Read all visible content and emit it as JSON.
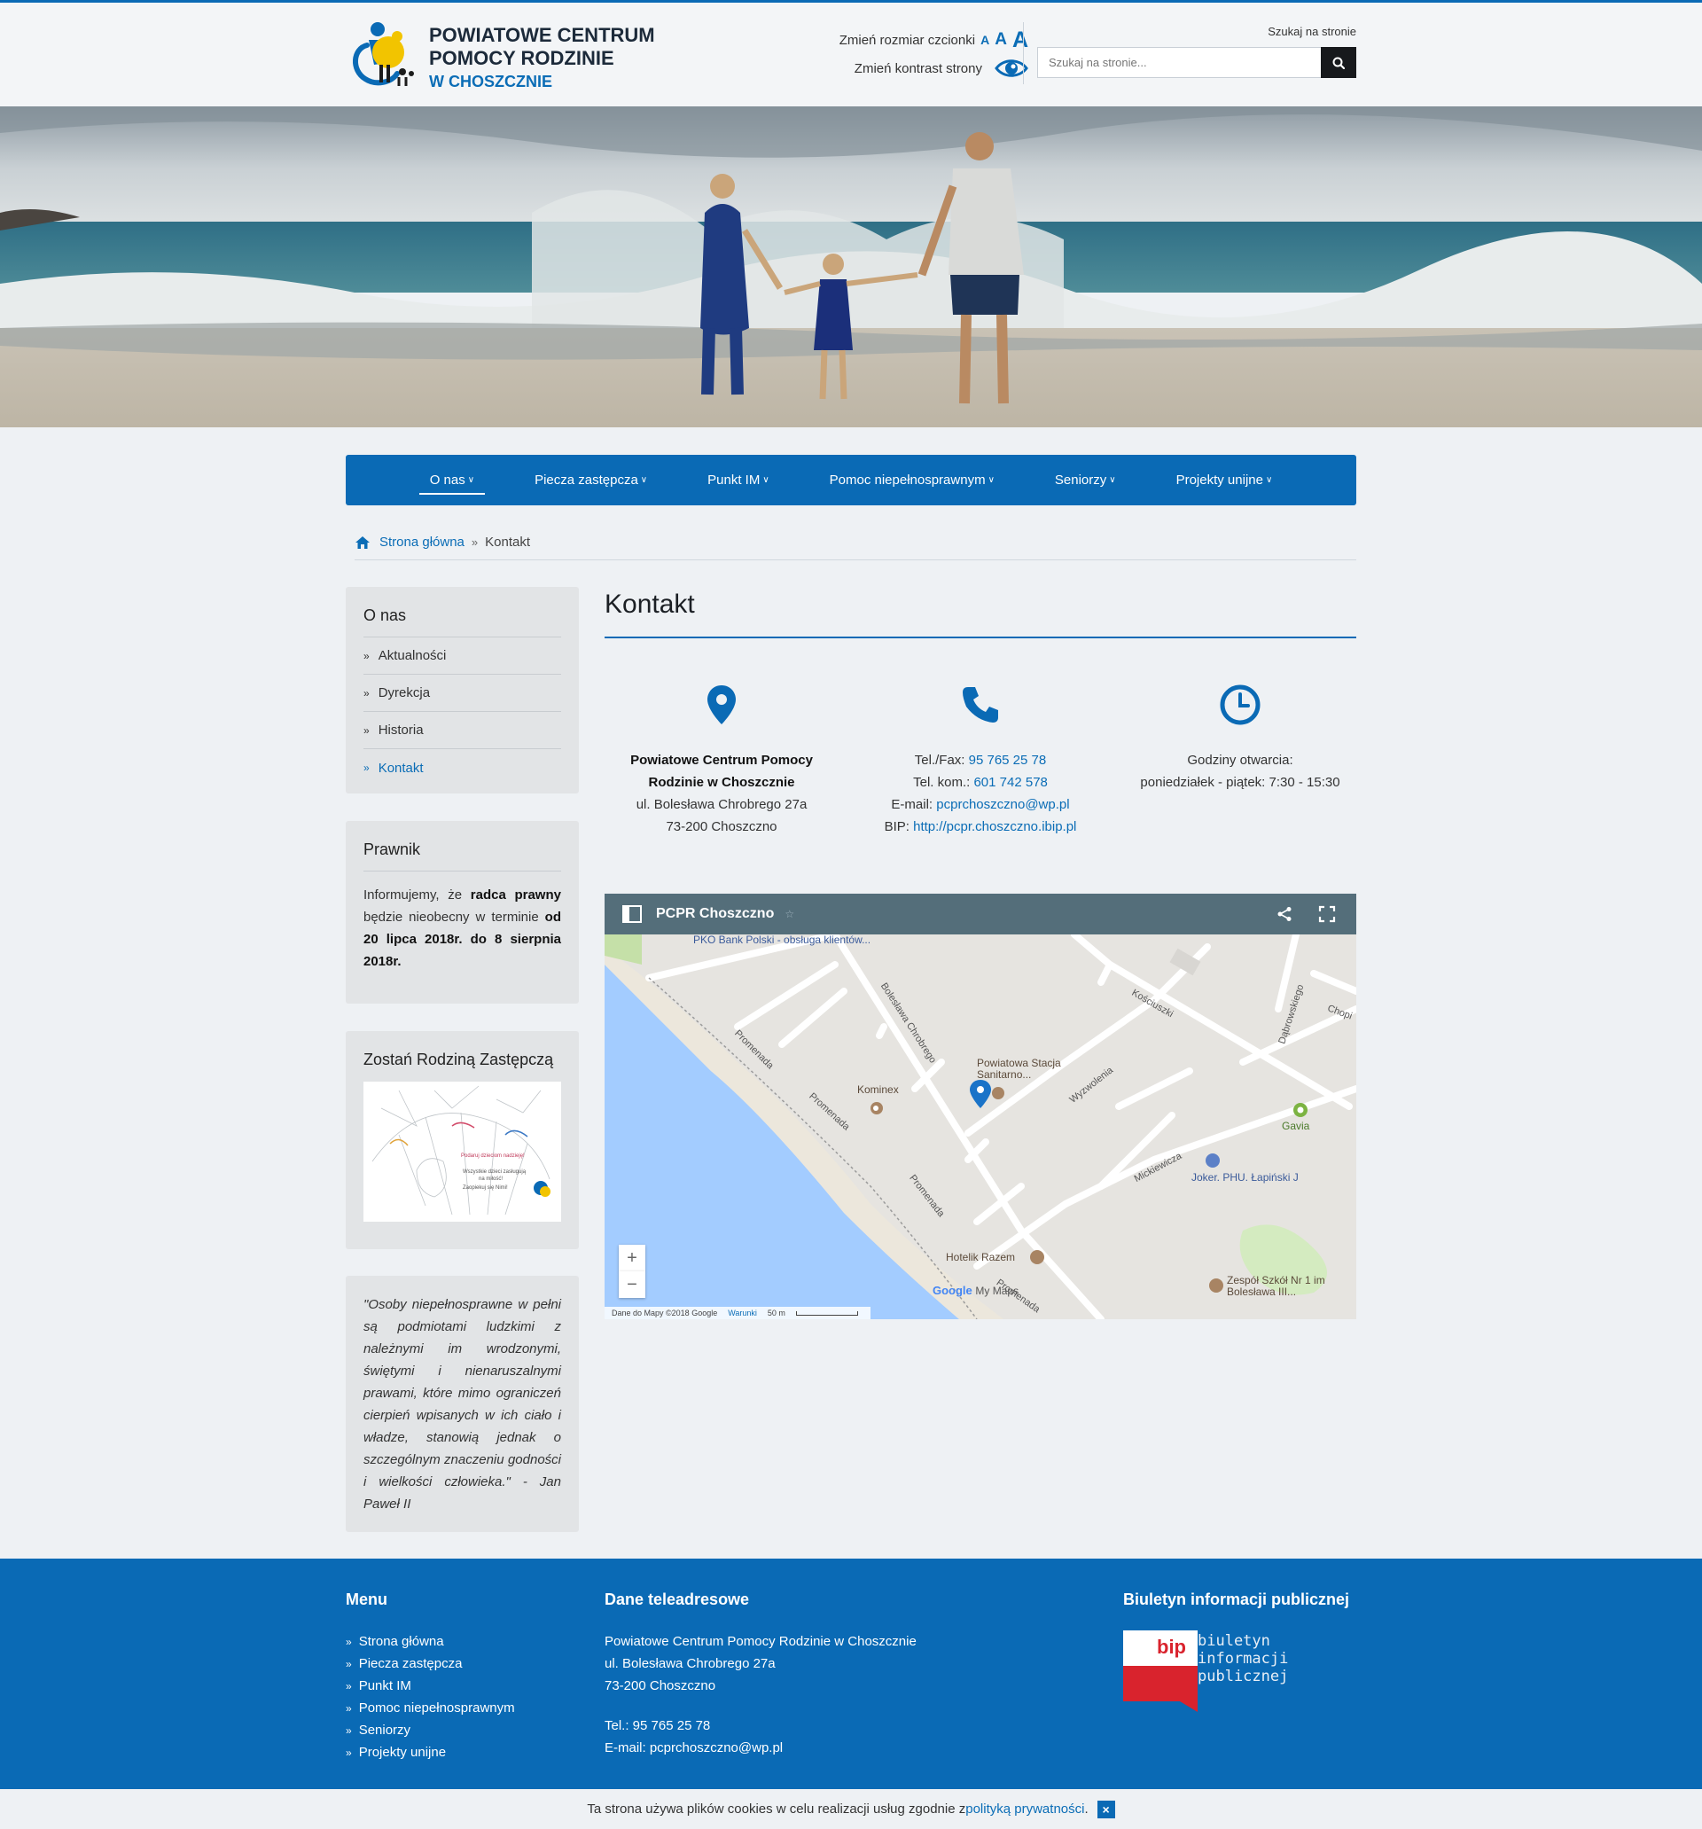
{
  "header": {
    "logo_line1": "POWIATOWE CENTRUM",
    "logo_line2": "POMOCY RODZINIE",
    "logo_line3": "W CHOSZCZNIE",
    "font_size_label": "Zmień rozmiar czcionki",
    "font_sizes": [
      "A",
      "A",
      "A"
    ],
    "contrast_label": "Zmień kontrast strony",
    "search_label": "Szukaj na stronie",
    "search_placeholder": "Szukaj na stronie..."
  },
  "nav": {
    "items": [
      {
        "label": "O nas"
      },
      {
        "label": "Piecza zastępcza"
      },
      {
        "label": "Punkt IM"
      },
      {
        "label": "Pomoc niepełnosprawnym"
      },
      {
        "label": "Seniorzy"
      },
      {
        "label": "Projekty unijne"
      }
    ]
  },
  "breadcrumb": {
    "home": "Strona główna",
    "current": "Kontakt"
  },
  "sidebar": {
    "onas": {
      "title": "O nas",
      "items": [
        "Aktualności",
        "Dyrekcja",
        "Historia",
        "Kontakt"
      ]
    },
    "prawnik": {
      "title": "Prawnik",
      "t1": "Informujemy, że ",
      "t2": "radca prawny",
      "t3": " będzie nieobecny w terminie ",
      "t4": "od 20 lipca 2018r. do 8 sierpnia 2018r."
    },
    "rodzina": {
      "title": "Zostań Rodziną Zastępczą",
      "poster_line1": "Podaruj dzieciom nadzieję!",
      "poster_line2": "Wszystkie dzieci zasługują",
      "poster_line3": "na miłość!",
      "poster_line4": "Zaopiekuj się Nimi!"
    },
    "quote": "\"Osoby niepełnosprawne w pełni są podmiotami ludzkimi z należnymi im wrodzonymi, świętymi i nienaruszalnymi prawami, które mimo ograniczeń cierpień wpisanych w ich ciało i władze, stanowią jednak o szczególnym znaczeniu godności i wielkości człowieka.\" - Jan Paweł II"
  },
  "main": {
    "title": "Kontakt",
    "address": {
      "name1": "Powiatowe Centrum Pomocy",
      "name2": "Rodzinie w Choszcznie",
      "street": "ul. Bolesława Chrobrego 27a",
      "city": "73-200 Choszczno"
    },
    "contact": {
      "tel_label": "Tel./Fax: ",
      "tel": "95 765 25 78",
      "mobile_label": "Tel. kom.: ",
      "mobile": "601 742 578",
      "email_label": "E-mail: ",
      "email": "pcprchoszczno@wp.pl",
      "bip_label": "BIP: ",
      "bip": "http://pcpr.choszczno.ibip.pl"
    },
    "hours": {
      "label": "Godziny otwarcia:",
      "value": "poniedziałek - piątek: 7:30 - 15:30"
    }
  },
  "map": {
    "title": "PCPR Choszczno",
    "places": {
      "pko": "PKO Bank Polski - obsługa klientów...",
      "stacja": "Powiatowa Stacja Sanitarno...",
      "kominex": "Kominex",
      "gavia": "Gavia",
      "joker": "Joker. PHU. Łapiński J",
      "hotelik": "Hotelik Razem",
      "zespol": "Zespół Szkół Nr 1 im Bolesława III..."
    },
    "streets": {
      "chrobrego": "Bolesława Chrobrego",
      "kosciuszki": "Kościuszki",
      "dabrowskiego": "Dąbrowskiego",
      "chopina": "Chopi",
      "wyzwolenia": "Wyzwolenia",
      "mickiewicza": "Mickiewicza",
      "promenada": "Promenada"
    },
    "google": "Google",
    "mymaps": "My Maps",
    "attribution": "Dane do Mapy ©2018 Google",
    "terms": "Warunki",
    "scale": "50 m",
    "zoom_in": "+",
    "zoom_out": "−"
  },
  "footer": {
    "menu_title": "Menu",
    "menu_items": [
      "Strona główna",
      "Piecza zastępcza",
      "Punkt IM",
      "Pomoc niepełnosprawnym",
      "Seniorzy",
      "Projekty unijne"
    ],
    "contact_title": "Dane teleadresowe",
    "contact_name": "Powiatowe Centrum Pomocy Rodzinie w Choszcznie",
    "contact_street": "ul. Bolesława Chrobrego 27a",
    "contact_city": "73-200 Choszczno",
    "contact_tel": "Tel.: 95 765 25 78",
    "contact_email": "E-mail: pcprchoszczno@wp.pl",
    "bip_title": "Biuletyn informacji publicznej",
    "bip_logo": "bip",
    "bip_text1": "biuletyn",
    "bip_text2": "informacji publicznej"
  },
  "cookie": {
    "text": "Ta strona używa plików cookies w celu realizacji usług zgodnie z ",
    "link": "polityką prywatności",
    "end": ".",
    "close": "×"
  },
  "colors": {
    "primary": "#0a6ab5",
    "sidebar_bg": "#e2e4e6",
    "page_bg": "#eef1f4",
    "map_bar": "#546e7a"
  }
}
